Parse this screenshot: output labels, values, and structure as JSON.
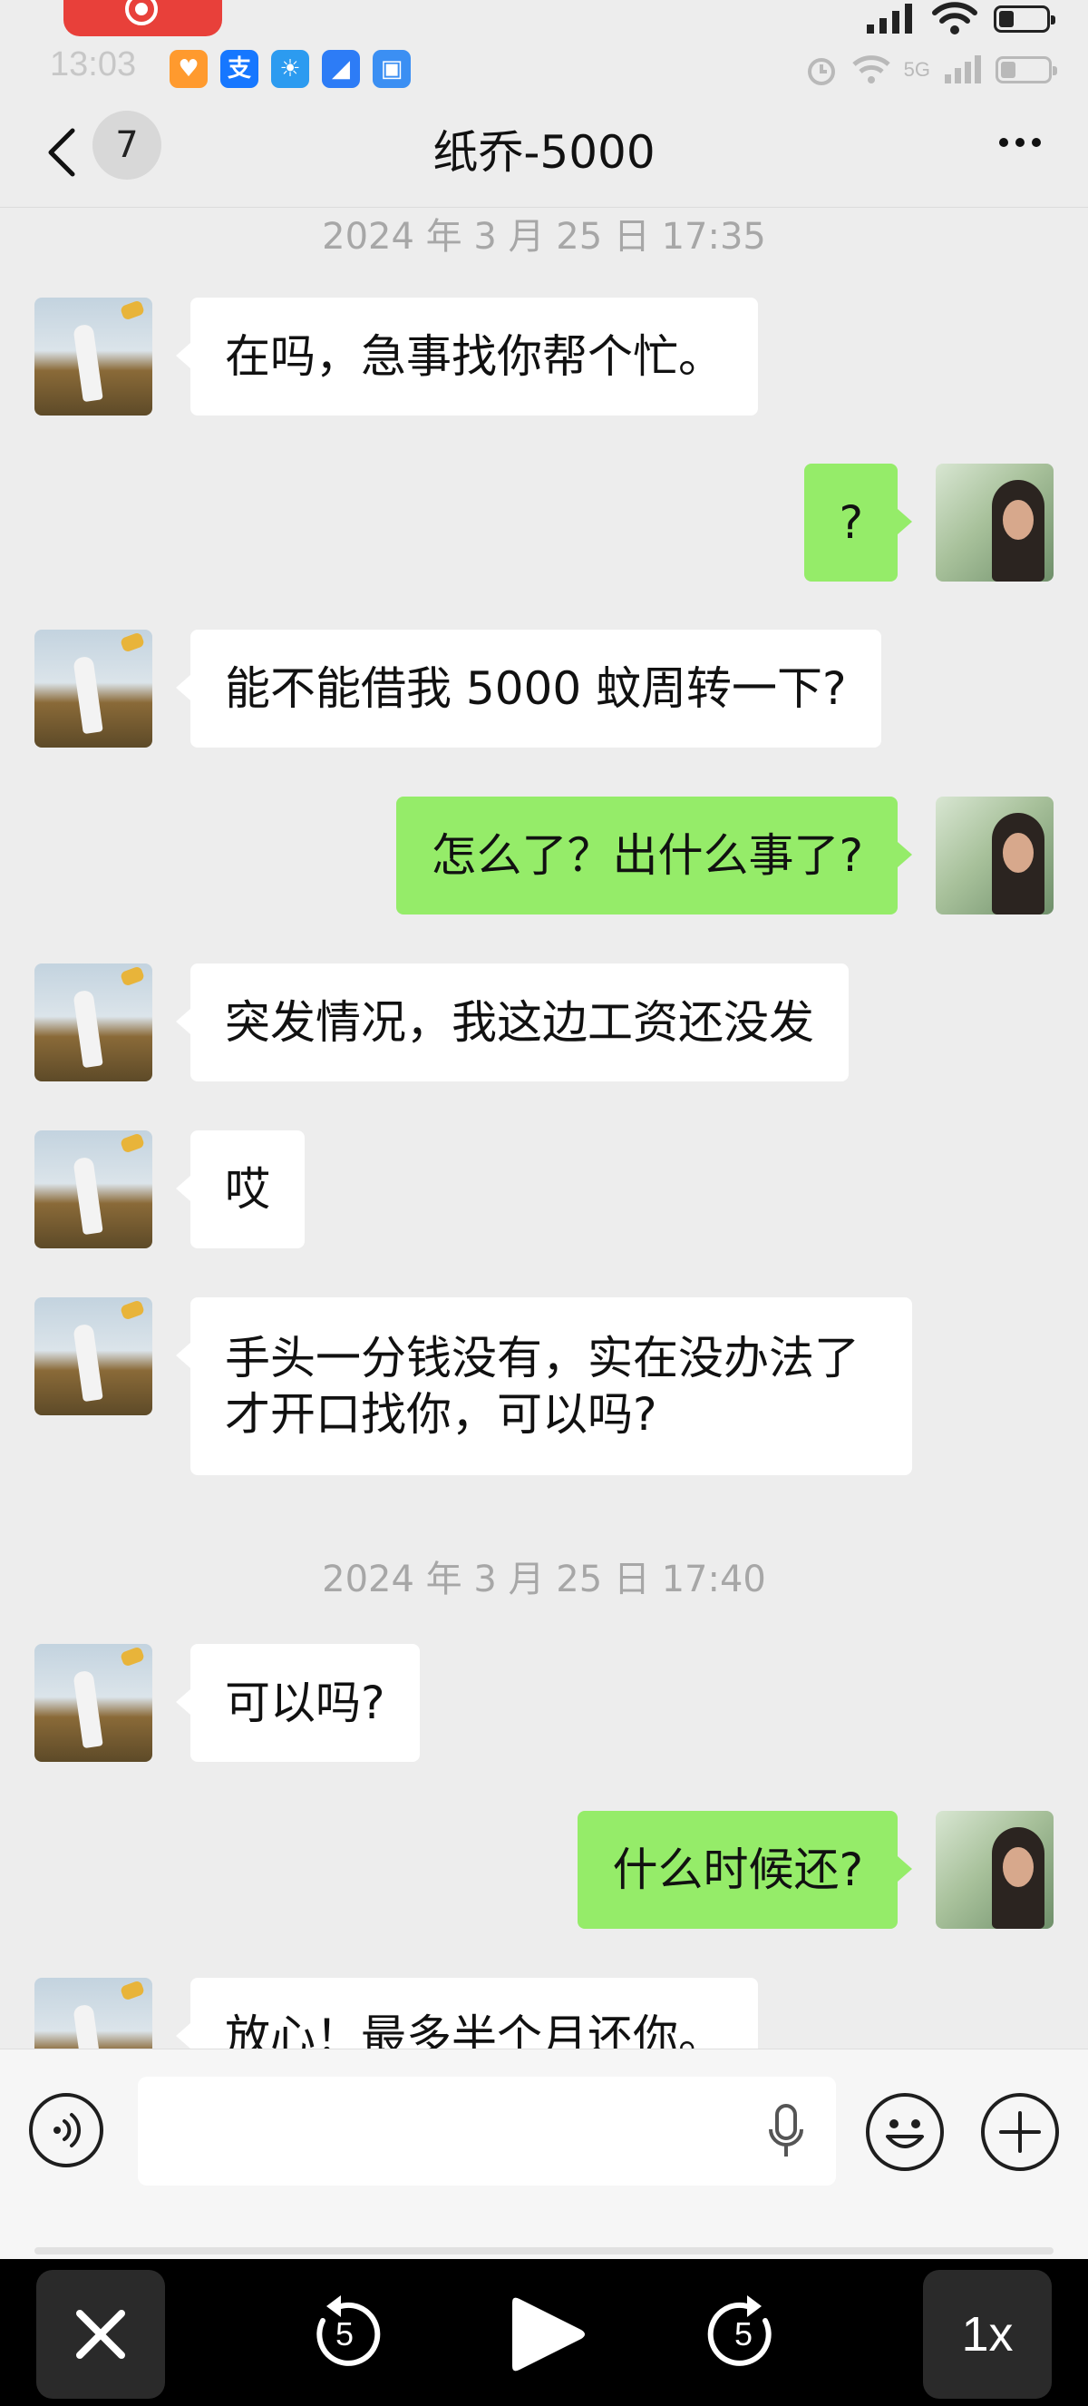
{
  "status_bar": {
    "time": "13:03",
    "network": "5G",
    "app_icons": [
      {
        "name": "heart-app-icon",
        "glyph": "♥",
        "color": "#ff9a2e"
      },
      {
        "name": "alipay-icon",
        "glyph": "支",
        "color": "#1677ff"
      },
      {
        "name": "weather-icon",
        "glyph": "☀",
        "color": "#2c9bf0"
      },
      {
        "name": "compass-app-icon",
        "glyph": "◢",
        "color": "#2d7cf6"
      },
      {
        "name": "wallet-app-icon",
        "glyph": "▣",
        "color": "#3b8ff3"
      }
    ]
  },
  "nav": {
    "unread_count": "7",
    "title": "纸乔-5000"
  },
  "timestamps": [
    "2024 年 3 月 25 日 17:35",
    "2024 年 3 月 25 日 17:40"
  ],
  "messages": [
    {
      "side": "left",
      "text": "在吗，急事找你帮个忙。"
    },
    {
      "side": "right",
      "text": "?"
    },
    {
      "side": "left",
      "text": "能不能借我 5000 蚊周转一下?"
    },
    {
      "side": "right",
      "text": "怎么了？出什么事了?"
    },
    {
      "side": "left",
      "text": "突发情况，我这边工资还没发"
    },
    {
      "side": "left",
      "text": "哎"
    },
    {
      "side": "left",
      "text": "手头一分钱没有，实在没办法了才开口找你，可以吗?"
    },
    {
      "side": "left",
      "text": "可以吗?"
    },
    {
      "side": "right",
      "text": "什么时候还?"
    },
    {
      "side": "left",
      "text": "放心！最多半个月还你。"
    }
  ],
  "player": {
    "rewind_seconds": "5",
    "forward_seconds": "5",
    "speed": "1x"
  },
  "colors": {
    "background": "#ededed",
    "bubble_self": "#95ec69",
    "bubble_other": "#ffffff",
    "record_indicator": "#e8403a"
  }
}
